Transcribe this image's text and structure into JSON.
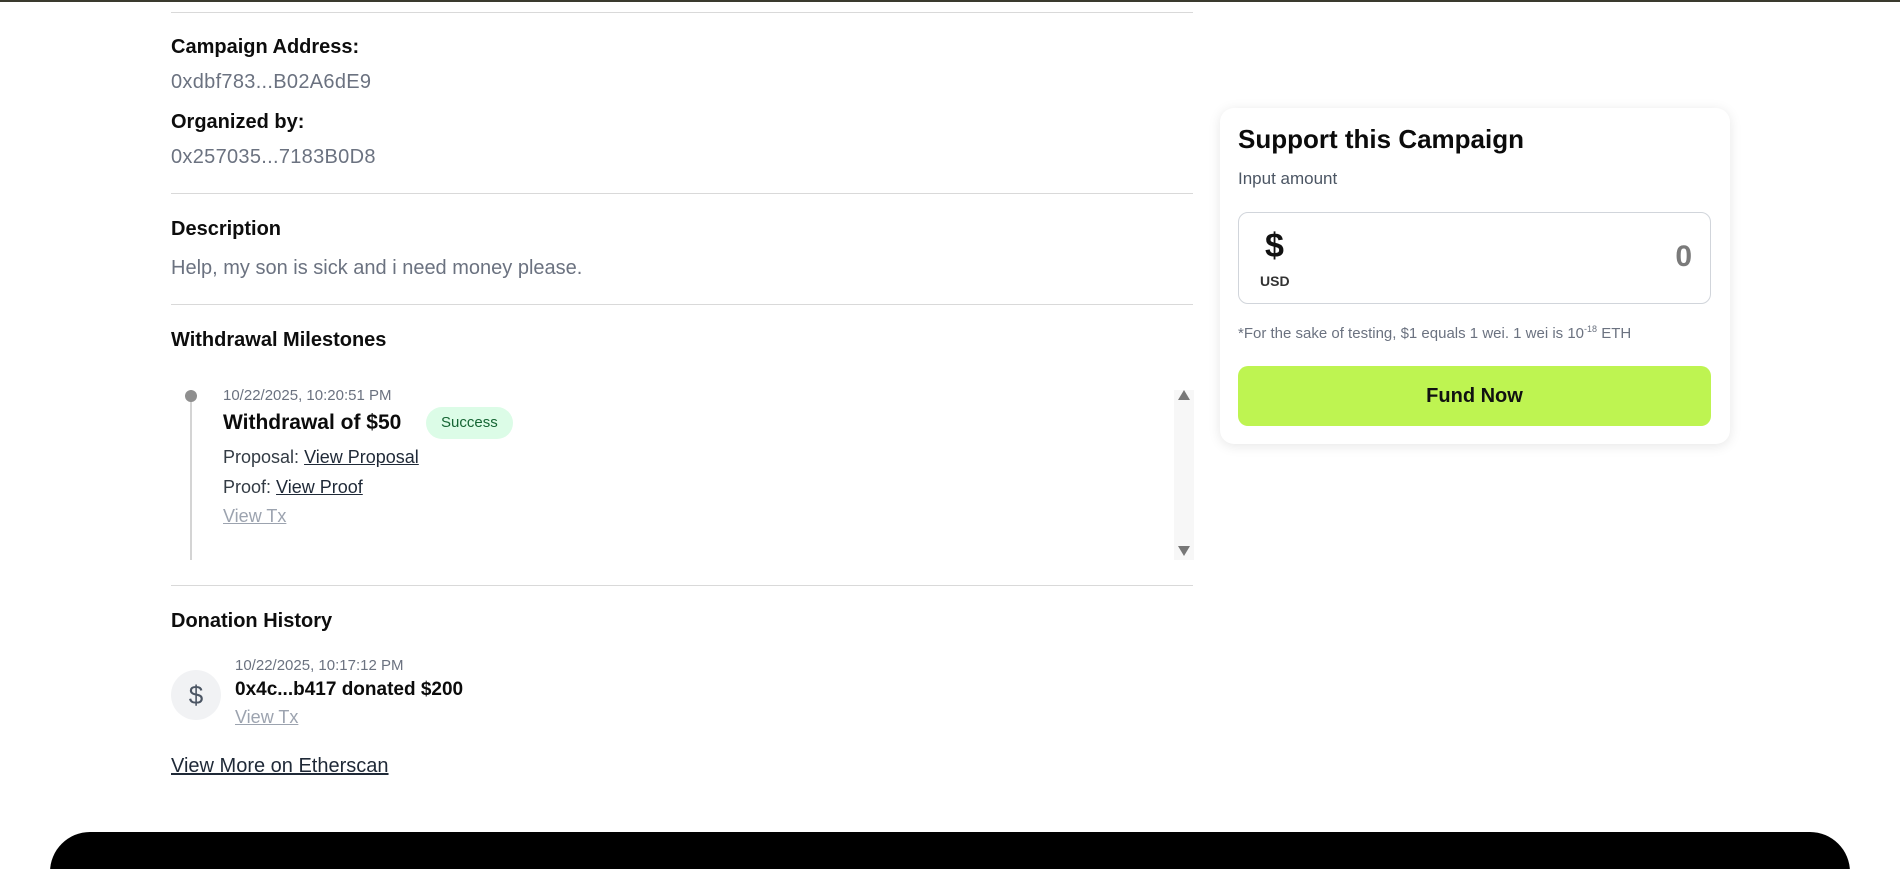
{
  "campaign": {
    "address_label": "Campaign Address:",
    "address_value": "0xdbf783...B02A6dE9",
    "organizer_label": "Organized by:",
    "organizer_value": "0x257035...7183B0D8"
  },
  "description": {
    "title": "Description",
    "text": "Help, my son is sick and i need money please."
  },
  "milestones": {
    "title": "Withdrawal Milestones",
    "items": [
      {
        "timestamp": "10/22/2025, 10:20:51 PM",
        "title": "Withdrawal of $50",
        "status": "Success",
        "proposal_label": "Proposal:",
        "proposal_link": "View Proposal",
        "proof_label": "Proof:",
        "proof_link": "View Proof",
        "tx_link": "View Tx"
      }
    ]
  },
  "donations": {
    "title": "Donation History",
    "items": [
      {
        "icon": "dollar-icon",
        "timestamp": "10/22/2025, 10:17:12 PM",
        "text": "0x4c...b417 donated $200",
        "tx_link": "View Tx"
      }
    ],
    "more_link": "View More on Etherscan"
  },
  "support_card": {
    "title": "Support this Campaign",
    "subtitle": "Input amount",
    "currency_symbol": "$",
    "currency_code": "USD",
    "amount_placeholder": "0",
    "note_prefix": "*For the sake of testing, $1 equals 1 wei. 1 wei is 10",
    "note_exponent": "-18",
    "note_suffix": " ETH",
    "button_label": "Fund Now"
  },
  "colors": {
    "accent": "#bef451",
    "success_bg": "#dcfce7",
    "success_text": "#166534",
    "footer": "#000000"
  }
}
